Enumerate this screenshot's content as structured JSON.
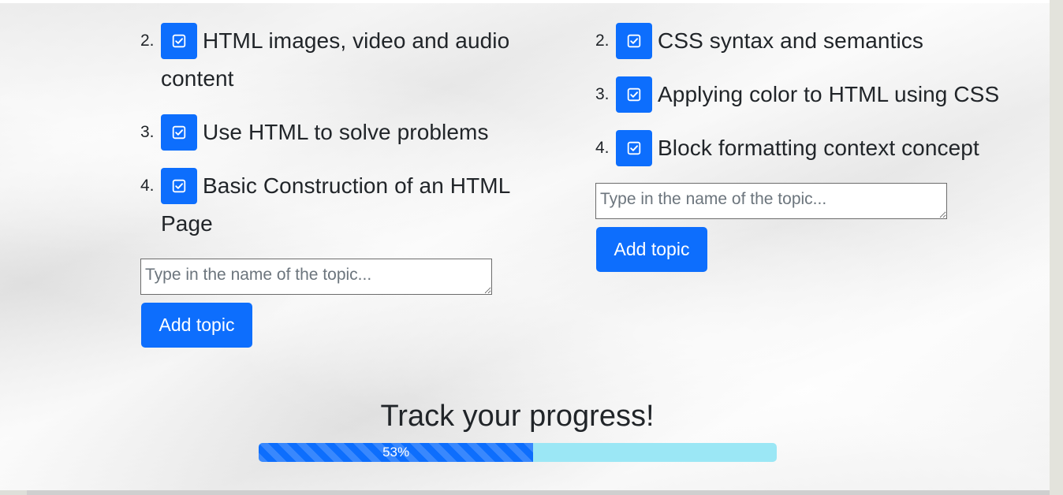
{
  "colors": {
    "accent": "#0d6efd",
    "progress_track": "#9be7f5",
    "text": "#212529"
  },
  "left_column": {
    "topics": [
      {
        "number": "2.",
        "label": "HTML images, video and audio content",
        "checked": true,
        "icon": "check-square-icon"
      },
      {
        "number": "3.",
        "label": "Use HTML to solve problems",
        "checked": true,
        "icon": "check-square-icon"
      },
      {
        "number": "4.",
        "label": "Basic Construction of an HTML Page",
        "checked": true,
        "icon": "check-square-icon"
      }
    ],
    "input_placeholder": "Type in the name of the topic...",
    "add_button_label": "Add topic"
  },
  "right_column": {
    "topics": [
      {
        "number": "2.",
        "label": "CSS syntax and semantics",
        "checked": true,
        "icon": "check-square-icon"
      },
      {
        "number": "3.",
        "label": "Applying color to HTML using CSS",
        "checked": true,
        "icon": "check-square-icon"
      },
      {
        "number": "4.",
        "label": "Block formatting context concept",
        "checked": true,
        "icon": "check-square-icon"
      }
    ],
    "input_placeholder": "Type in the name of the topic...",
    "add_button_label": "Add topic"
  },
  "progress": {
    "title": "Track your progress!",
    "label": "53%",
    "percent": 53
  }
}
